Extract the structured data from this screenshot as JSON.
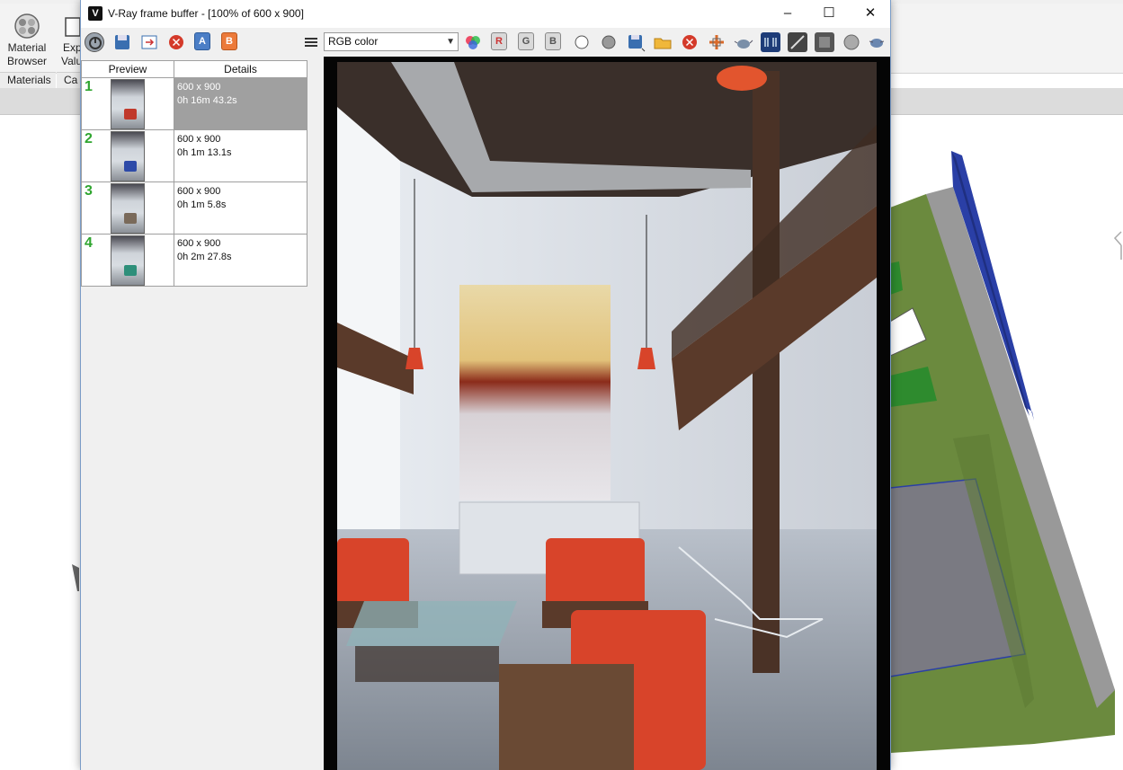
{
  "host": {
    "tools": [
      {
        "label_1": "Material",
        "label_2": "Browser",
        "icon": "material-browser-icon"
      },
      {
        "label_1": "Exp",
        "label_2": "Valu",
        "icon": "export-icon"
      }
    ],
    "groups": [
      "Materials",
      "Ca"
    ]
  },
  "vfb": {
    "title": "V-Ray frame buffer - [100% of 600 x 900]",
    "logo_text": "V",
    "channel": "RGB color",
    "letters": {
      "a": "A",
      "b": "B",
      "r": "R",
      "g": "G",
      "bl": "B"
    },
    "history": {
      "headers": {
        "preview": "Preview",
        "details": "Details"
      },
      "rows": [
        {
          "num": "1",
          "size": "600 x 900",
          "time": "0h 16m 43.2s",
          "selected": true,
          "chair": "#c0392b"
        },
        {
          "num": "2",
          "size": "600 x 900",
          "time": "0h 1m 13.1s",
          "selected": false,
          "chair": "#2d4aa8"
        },
        {
          "num": "3",
          "size": "600 x 900",
          "time": "0h 1m 5.8s",
          "selected": false,
          "chair": "#7a6a5a"
        },
        {
          "num": "4",
          "size": "600 x 900",
          "time": "0h 2m 27.8s",
          "selected": false,
          "chair": "#2e8f7a"
        }
      ]
    }
  },
  "colors": {
    "history_number": "#2fa52f",
    "selected_row": "#a0a0a0",
    "chair_orange": "#d8442a",
    "model_green": "#6b8a3e",
    "model_blue": "#2a3fa6"
  }
}
